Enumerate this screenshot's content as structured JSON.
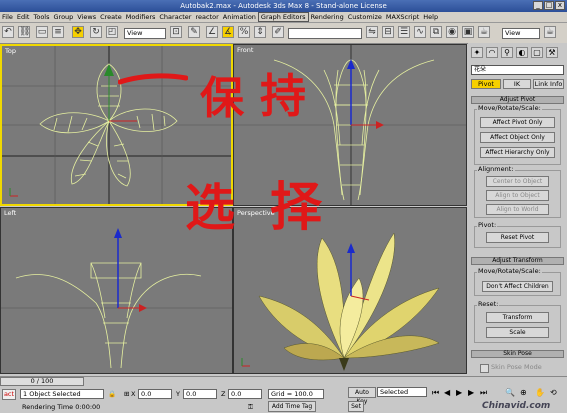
{
  "window": {
    "title": "Autobak2.max - Autodesk 3ds Max 8  - Stand-alone License",
    "min": "_",
    "max": "□",
    "close": "x"
  },
  "menu": [
    "File",
    "Edit",
    "Tools",
    "Group",
    "Views",
    "Create",
    "Modifiers",
    "Character",
    "reactor",
    "Animation",
    "Graph Editors",
    "Rendering",
    "Customize",
    "MAXScript",
    "Help"
  ],
  "toolbar": {
    "ref_coord": "View",
    "named_sel": "",
    "render_view": "View"
  },
  "viewports": {
    "top": "Top",
    "front": "Front",
    "left": "Left",
    "perspective": "Perspective"
  },
  "command_panel": {
    "object_name": "花朵",
    "tabs": [
      "Pivot",
      "IK",
      "Link Info"
    ],
    "rollouts": {
      "adjust_pivot": "Adjust Pivot",
      "move_rotate_scale": "Move/Rotate/Scale:",
      "affect_pivot_only": "Affect Pivot Only",
      "affect_object_only": "Affect Object Only",
      "affect_hierarchy_only": "Affect Hierarchy Only",
      "alignment": "Alignment:",
      "center_to_object": "Center to Object",
      "align_to_object": "Align to Object",
      "align_to_world": "Align to World",
      "pivot": "Pivot:",
      "reset_pivot": "Reset Pivot",
      "adjust_transform": "Adjust Transform",
      "move_rotate_scale_2": "Move/Rotate/Scale:",
      "dont_affect_children": "Don't Affect Children",
      "reset": "Reset:",
      "transform": "Transform",
      "scale": "Scale",
      "skin_pose": "Skin Pose",
      "skin_pose_mode": "Skin Pose Mode"
    }
  },
  "status": {
    "frame": "0 / 100",
    "selected": "1 Object Selected",
    "rendering_time": "Rendering Time  0:00:00",
    "x_label": "X",
    "x_val": "0.0",
    "y_label": "Y",
    "y_val": "0.0",
    "z_label": "Z",
    "z_val": "0.0",
    "grid": "Grid = 100.0",
    "add_time_tag": "Add Time Tag",
    "auto_key": "Auto Key",
    "key_filter": "Selected",
    "set_key": "Set",
    "watermark": "Chinavid.com",
    "act": "act"
  },
  "overlay": {
    "marks": [
      "保",
      "持",
      "选",
      "择"
    ]
  },
  "colors": {
    "accent": "#f6d000",
    "viewport_bg": "#7a7a7a",
    "wire": "#e6f0a0",
    "annotation": "#e01818"
  }
}
